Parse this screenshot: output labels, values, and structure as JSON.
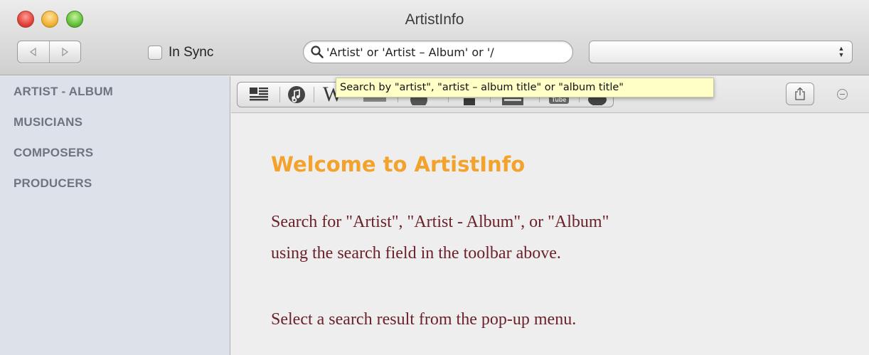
{
  "window": {
    "title": "ArtistInfo"
  },
  "toolbar": {
    "back_icon": "triangle-left-icon",
    "forward_icon": "triangle-right-icon",
    "sync_label": "In Sync",
    "search": {
      "value": "'Artist' or 'Artist – Album' or '/"
    },
    "popup_value": ""
  },
  "sidebar": {
    "items": [
      {
        "label": "ARTIST - ALBUM"
      },
      {
        "label": "MUSICIANS"
      },
      {
        "label": "COMPOSERS"
      },
      {
        "label": "PRODUCERS"
      }
    ]
  },
  "source_bar": {
    "buttons": [
      {
        "icon": "text-lines-icon"
      },
      {
        "icon": "music-note-icon"
      },
      {
        "icon": "wikipedia-icon",
        "glyph": "W"
      },
      {
        "icon": "discogs-icon"
      },
      {
        "icon": "disc-icon"
      },
      {
        "icon": "home-icon"
      },
      {
        "icon": "video-icon"
      },
      {
        "icon": "youtube-icon",
        "glyph": "Tube"
      },
      {
        "icon": "lastfm-icon"
      }
    ]
  },
  "tooltip": {
    "text": "Search by \"artist\", \"artist – album title\" or \"album title\""
  },
  "content": {
    "heading": "Welcome to ArtistInfo",
    "lines": [
      "Search for \"Artist\", \"Artist - Album\", or \"Album\"",
      "using the search field in the toolbar above.",
      "Select a search result from the pop-up menu."
    ]
  },
  "colors": {
    "heading": "#f3a22b",
    "body_text": "#6b2129",
    "sidebar_bg": "#dde2ea",
    "sidebar_text": "#6e7480",
    "tooltip_bg": "#ffffc6"
  }
}
